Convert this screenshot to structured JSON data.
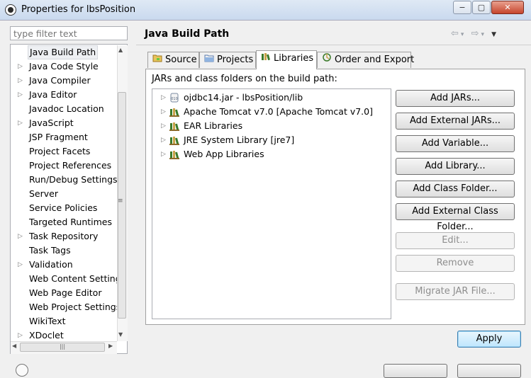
{
  "window": {
    "title": "Properties for lbsPosition",
    "minimize_label": "−",
    "maximize_label": "▢",
    "close_label": "✕"
  },
  "sidebar": {
    "filter_placeholder": "type filter text",
    "items": [
      {
        "label": "Java Build Path",
        "expandable": false,
        "selected": true
      },
      {
        "label": "Java Code Style",
        "expandable": true
      },
      {
        "label": "Java Compiler",
        "expandable": true
      },
      {
        "label": "Java Editor",
        "expandable": true
      },
      {
        "label": "Javadoc Location",
        "expandable": false
      },
      {
        "label": "JavaScript",
        "expandable": true
      },
      {
        "label": "JSP Fragment",
        "expandable": false
      },
      {
        "label": "Project Facets",
        "expandable": false
      },
      {
        "label": "Project References",
        "expandable": false
      },
      {
        "label": "Run/Debug Settings",
        "expandable": false
      },
      {
        "label": "Server",
        "expandable": false
      },
      {
        "label": "Service Policies",
        "expandable": false
      },
      {
        "label": "Targeted Runtimes",
        "expandable": false
      },
      {
        "label": "Task Repository",
        "expandable": true
      },
      {
        "label": "Task Tags",
        "expandable": false
      },
      {
        "label": "Validation",
        "expandable": true
      },
      {
        "label": "Web Content Settings",
        "expandable": false
      },
      {
        "label": "Web Page Editor",
        "expandable": false
      },
      {
        "label": "Web Project Settings",
        "expandable": false
      },
      {
        "label": "WikiText",
        "expandable": false
      },
      {
        "label": "XDoclet",
        "expandable": true
      }
    ]
  },
  "main": {
    "title": "Java Build Path",
    "tabs": [
      {
        "label": "Source",
        "icon": "source-folder-icon",
        "active": false
      },
      {
        "label": "Projects",
        "icon": "projects-icon",
        "active": false
      },
      {
        "label": "Libraries",
        "icon": "libraries-icon",
        "active": true
      },
      {
        "label": "Order and Export",
        "icon": "order-export-icon",
        "active": false
      }
    ],
    "libraries_label": "JARs and class folders on the build path:",
    "libraries": [
      {
        "label": "ojdbc14.jar - lbsPosition/lib",
        "icon": "jar-icon"
      },
      {
        "label": "Apache Tomcat v7.0 [Apache Tomcat v7.0]",
        "icon": "library-icon"
      },
      {
        "label": "EAR Libraries",
        "icon": "library-icon"
      },
      {
        "label": "JRE System Library [jre7]",
        "icon": "library-icon"
      },
      {
        "label": "Web App Libraries",
        "icon": "library-icon"
      }
    ],
    "buttons": {
      "add_jars": "Add JARs...",
      "add_external_jars": "Add External JARs...",
      "add_variable": "Add Variable...",
      "add_library": "Add Library...",
      "add_class_folder": "Add Class Folder...",
      "add_external_class_folder": "Add External Class Folder...",
      "edit": "Edit...",
      "remove": "Remove",
      "migrate_jar": "Migrate JAR File..."
    },
    "apply_label": "Apply"
  },
  "colors": {
    "accent_library": "#3a7a2a",
    "apply_border": "#3c7fb1"
  }
}
